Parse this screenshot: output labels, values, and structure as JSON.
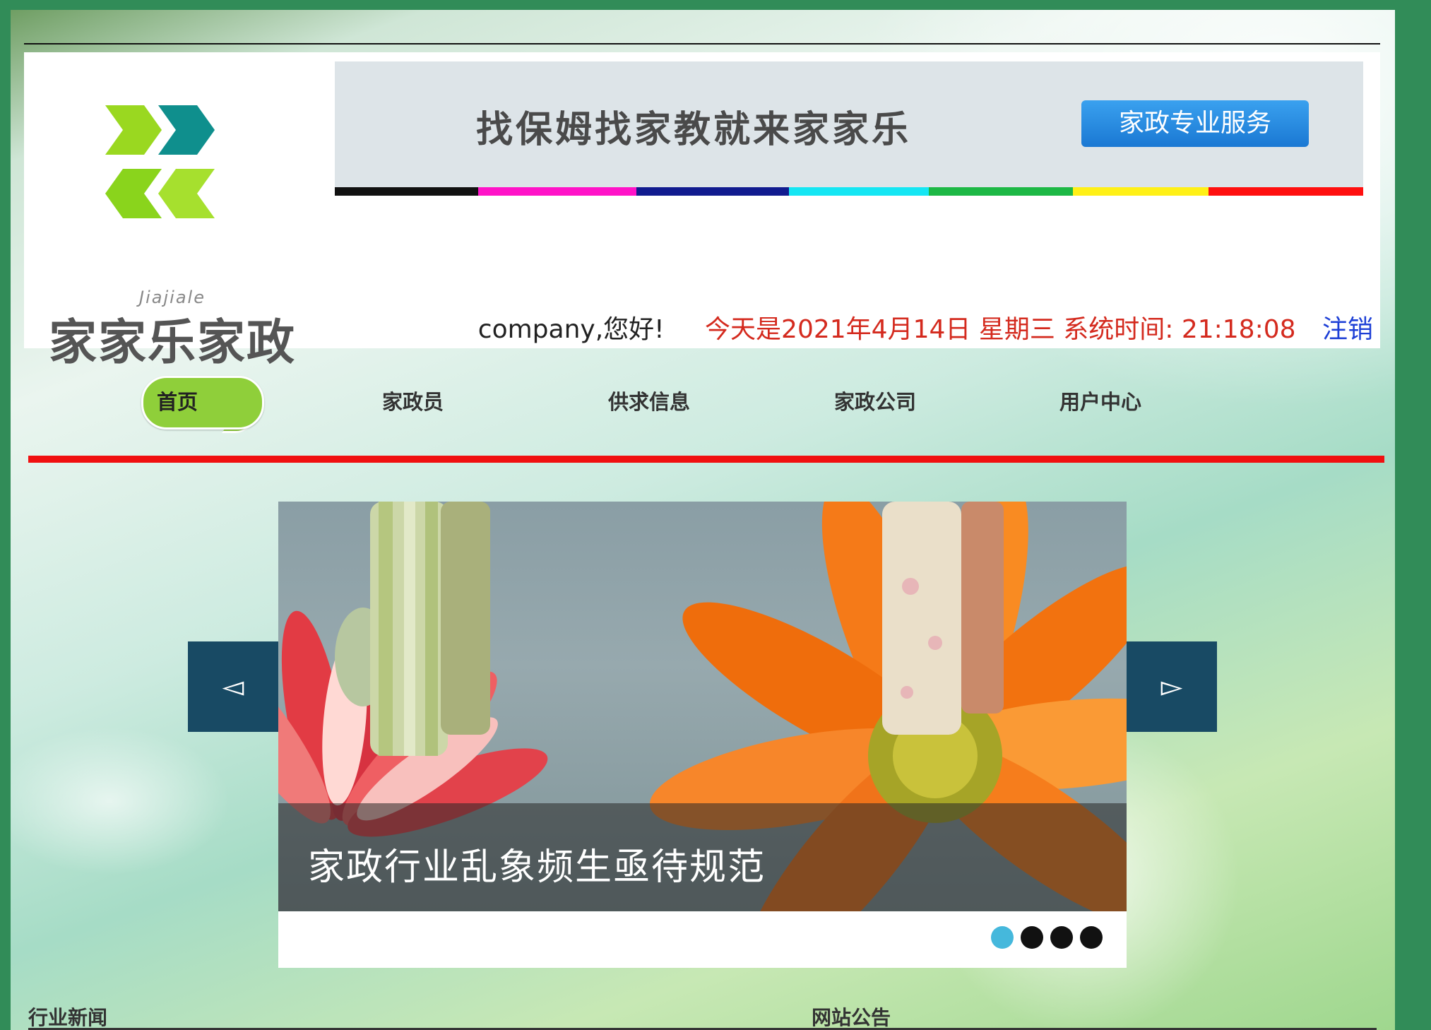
{
  "logo": {
    "sub": "Jiajiale",
    "title": "家家乐家政"
  },
  "banner": {
    "slogan": "找保姆找家教就来家家乐",
    "button_label": "家政专业服务",
    "strip_colors": [
      "#111111",
      "#ff13c8",
      "#111b8f",
      "#15e6f3",
      "#1db845",
      "#fff016",
      "#ff1010"
    ]
  },
  "status": {
    "greeting": "company,您好!",
    "today": "今天是2021年4月14日 星期三 系统时间: 21:18:08",
    "logout": "注销"
  },
  "nav": {
    "items": [
      {
        "label": "首页"
      },
      {
        "label": "家政员"
      },
      {
        "label": "供求信息"
      },
      {
        "label": "家政公司"
      },
      {
        "label": "用户中心"
      }
    ]
  },
  "slider": {
    "caption": "家政行业乱象频生亟待规范",
    "prev_label": "◅",
    "next_label": "▻",
    "dot_count": 4,
    "active_dot": 0
  },
  "sections": {
    "news": "行业新闻",
    "notice": "网站公告"
  },
  "colors": {
    "accent_green": "#8fcf3a",
    "nav_rule": "#f01010",
    "arrow_bg": "#184a64",
    "logout_blue": "#1d3fd6",
    "date_red": "#d42a1e"
  }
}
